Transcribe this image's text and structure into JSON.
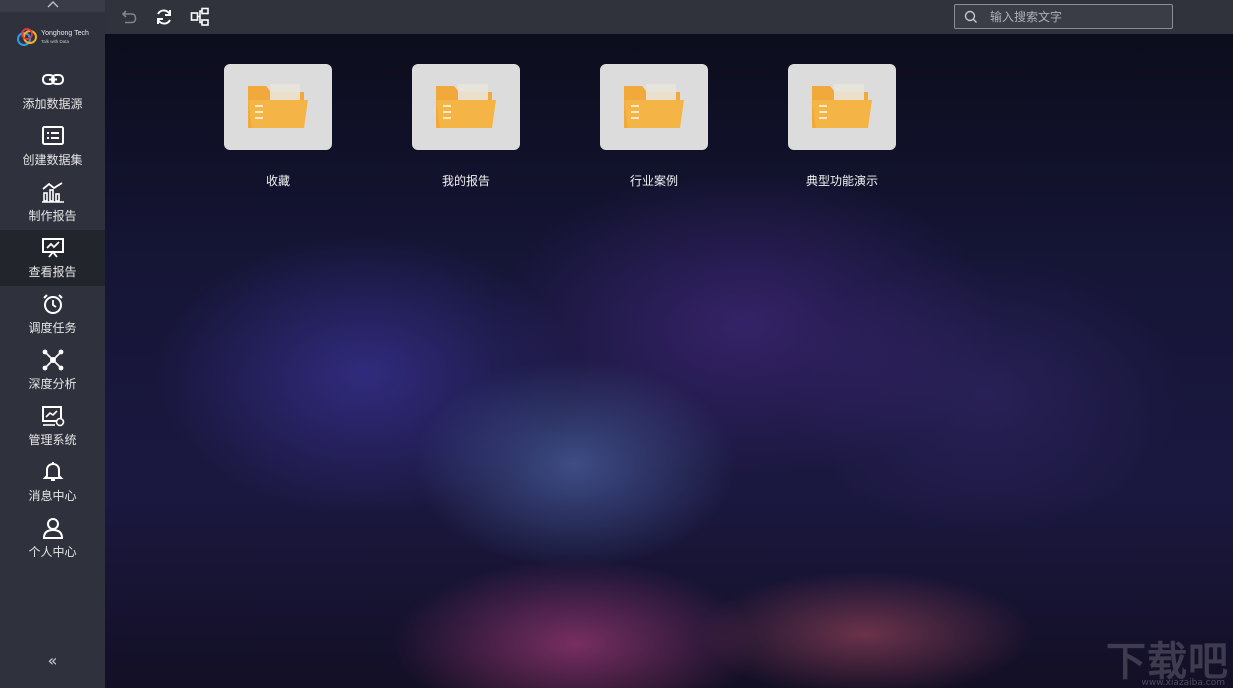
{
  "brand": {
    "name": "Yonghong Tech",
    "tagline": "Talk with Data"
  },
  "sidebar": {
    "items": [
      {
        "label": "添加数据源",
        "icon": "link-icon",
        "active": false
      },
      {
        "label": "创建数据集",
        "icon": "dataset-icon",
        "active": false
      },
      {
        "label": "制作报告",
        "icon": "chart-icon",
        "active": false
      },
      {
        "label": "查看报告",
        "icon": "presentation-icon",
        "active": true
      },
      {
        "label": "调度任务",
        "icon": "alarm-clock-icon",
        "active": false
      },
      {
        "label": "深度分析",
        "icon": "network-icon",
        "active": false
      },
      {
        "label": "管理系统",
        "icon": "monitor-gear-icon",
        "active": false
      },
      {
        "label": "消息中心",
        "icon": "bell-icon",
        "active": false
      },
      {
        "label": "个人中心",
        "icon": "user-icon",
        "active": false
      }
    ],
    "collapse_glyph": "«",
    "expand_top_glyph": "^"
  },
  "toolbar": {
    "tools": [
      "undo-icon",
      "refresh-icon",
      "hierarchy-icon"
    ]
  },
  "search": {
    "placeholder": "输入搜索文字",
    "value": ""
  },
  "folders": [
    {
      "label": "收藏"
    },
    {
      "label": "我的报告"
    },
    {
      "label": "行业案例"
    },
    {
      "label": "典型功能演示"
    }
  ],
  "watermark": {
    "text": "下载吧",
    "sub": "www.xiazaiba.com"
  },
  "colors": {
    "sidebar_bg": "#2f323d",
    "sidebar_active_bg": "#23252d",
    "topbar_bg": "#30333c",
    "folder_yellow": "#f2a93b",
    "folder_card_bg": "#dcdcdc"
  }
}
